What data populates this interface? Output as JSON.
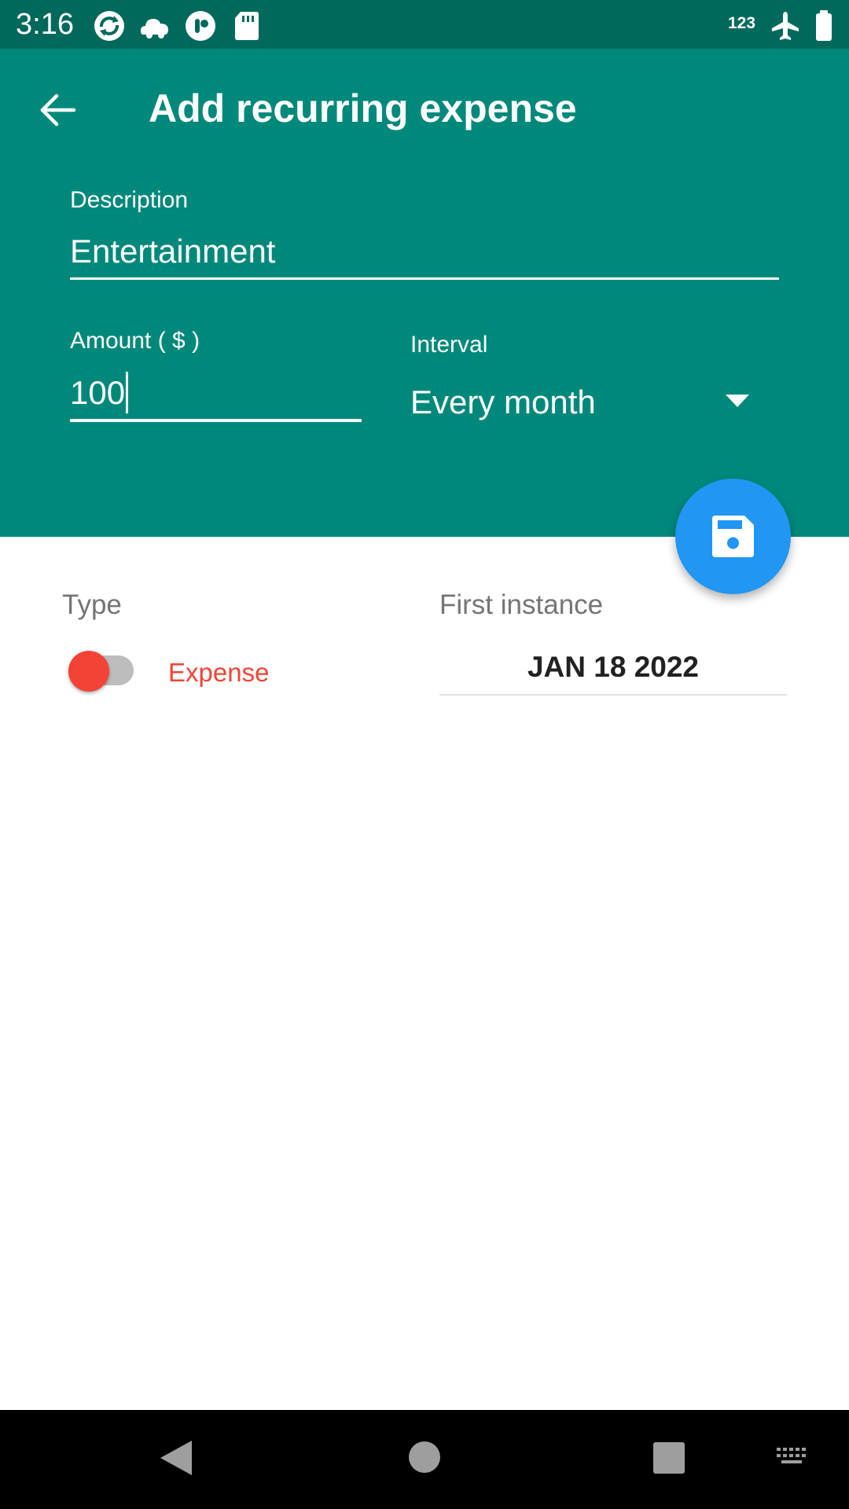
{
  "status_bar": {
    "time": "3:16",
    "indicator_text": "123",
    "icons": [
      "sync-icon",
      "cloud-icon",
      "app-icon",
      "sd-card-icon",
      "airplane-mode-icon",
      "battery-icon"
    ]
  },
  "header": {
    "title": "Add recurring expense",
    "back_icon": "arrow-back-icon"
  },
  "form": {
    "description_label": "Description",
    "description_value": "Entertainment",
    "amount_label": "Amount ( $ )",
    "amount_value": "100",
    "interval_label": "Interval",
    "interval_value": "Every month"
  },
  "fab": {
    "icon": "save-icon"
  },
  "details": {
    "type_label": "Type",
    "type_value": "Expense",
    "first_instance_label": "First instance",
    "first_instance_value": "JAN 18 2022"
  },
  "nav_bar": {
    "icons": [
      "back-triangle-icon",
      "home-circle-icon",
      "recents-square-icon",
      "keyboard-icon"
    ]
  },
  "colors": {
    "status_bar": "#00695c",
    "header": "#00897b",
    "fab": "#2196f3",
    "expense": "#f44336",
    "label_gray": "#757575"
  }
}
